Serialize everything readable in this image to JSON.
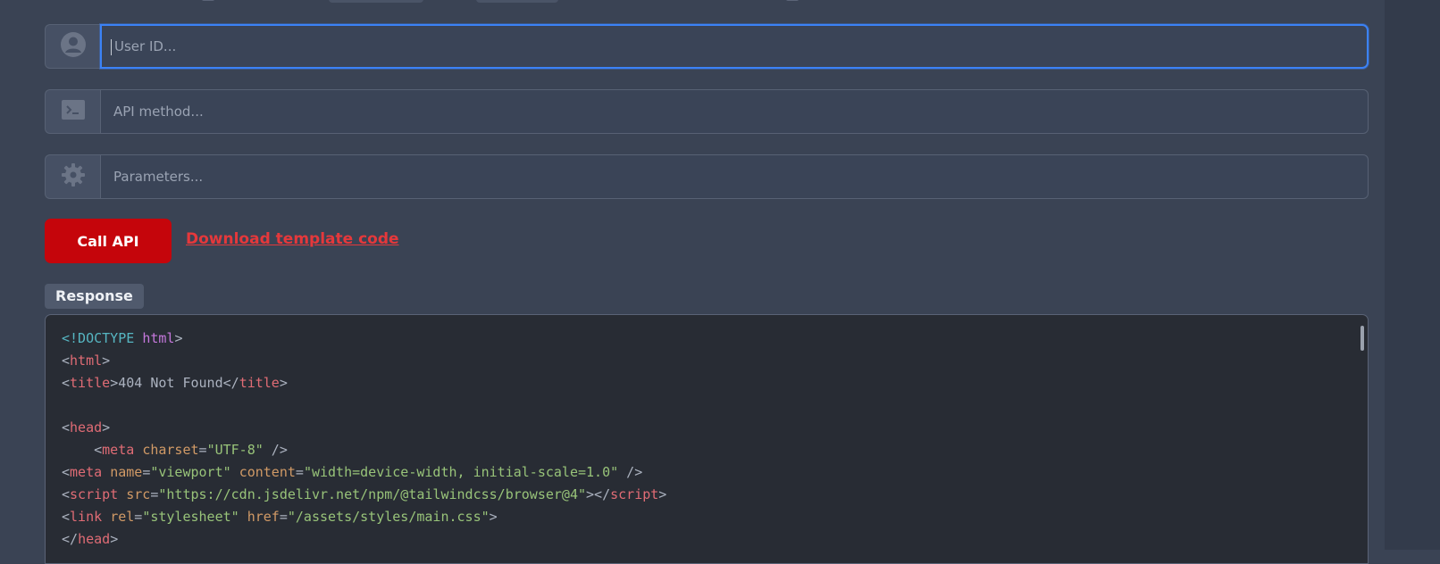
{
  "form": {
    "user_id": {
      "placeholder": "User ID...",
      "value": "",
      "icon": "user-circle-icon"
    },
    "api_method": {
      "placeholder": "API method...",
      "value": "",
      "icon": "terminal-icon"
    },
    "parameters": {
      "placeholder": "Parameters...",
      "value": "",
      "icon": "gear-icon"
    }
  },
  "actions": {
    "call_api_label": "Call API",
    "download_label": "Download template code"
  },
  "response": {
    "label": "Response",
    "code_lines": [
      [
        "<!DOCTYPE ",
        "html",
        ">"
      ],
      [
        "<",
        "html",
        ">"
      ],
      [
        "<",
        "title",
        ">",
        "404 Not Found",
        "</",
        "title",
        ">"
      ],
      [],
      [
        "<",
        "head",
        ">"
      ],
      [
        "    <",
        "meta",
        " ",
        "charset",
        "=",
        "\"UTF-8\"",
        " />"
      ],
      [
        "<",
        "meta",
        " ",
        "name",
        "=",
        "\"viewport\"",
        " ",
        "content",
        "=",
        "\"width=device-width, initial-scale=1.0\"",
        " />"
      ],
      [
        "<",
        "script",
        " ",
        "src",
        "=",
        "\"https://cdn.jsdelivr.net/npm/@tailwindcss/browser@4\"",
        "></",
        "script",
        ">"
      ],
      [
        "<",
        "link",
        " ",
        "rel",
        "=",
        "\"stylesheet\"",
        " ",
        "href",
        "=",
        "\"/assets/styles/main.css\"",
        ">"
      ],
      [
        "</",
        "head",
        ">"
      ]
    ]
  },
  "colors": {
    "background": "#3a4354",
    "accent_focus": "#3b82f6",
    "button_red": "#c5050b",
    "link_red": "#e5383b",
    "code_bg": "#282c34"
  }
}
